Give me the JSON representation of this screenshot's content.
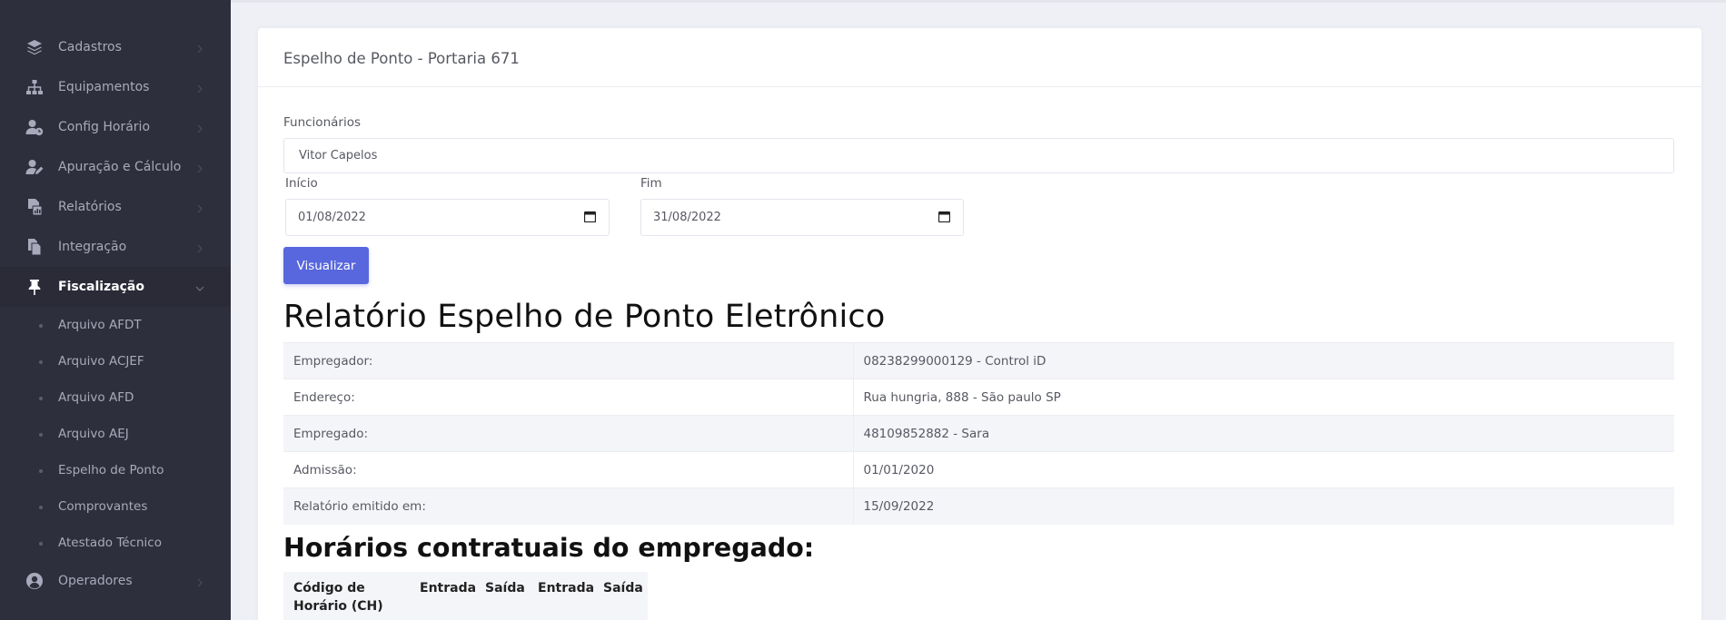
{
  "sidebar": {
    "items": [
      {
        "label": "Cadastros",
        "icon": "layers-icon"
      },
      {
        "label": "Equipamentos",
        "icon": "sitemap-icon"
      },
      {
        "label": "Config Horário",
        "icon": "user-clock-icon"
      },
      {
        "label": "Apuração e Cálculo",
        "icon": "user-edit-icon"
      },
      {
        "label": "Relatórios",
        "icon": "file-report-icon"
      },
      {
        "label": "Integração",
        "icon": "copy-files-icon"
      },
      {
        "label": "Fiscalização",
        "icon": "pin-icon"
      }
    ],
    "sub_items": [
      {
        "label": "Arquivo AFDT"
      },
      {
        "label": "Arquivo ACJEF"
      },
      {
        "label": "Arquivo AFD"
      },
      {
        "label": "Arquivo AEJ"
      },
      {
        "label": "Espelho de Ponto"
      },
      {
        "label": "Comprovantes"
      },
      {
        "label": "Atestado Técnico"
      }
    ],
    "bottom_item": {
      "label": "Operadores",
      "icon": "user-circle-icon"
    }
  },
  "card": {
    "title": "Espelho de Ponto - Portaria 671"
  },
  "form": {
    "employees_label": "Funcionários",
    "employees_value": "Vitor Capelos",
    "start_label": "Início",
    "start_value": "01/08/2022",
    "end_label": "Fim",
    "end_value": "31/08/2022",
    "submit_label": "Visualizar"
  },
  "report": {
    "title": "Relatório Espelho de Ponto Eletrônico",
    "rows": [
      {
        "key": "Empregador:",
        "value": "08238299000129 - Control iD"
      },
      {
        "key": "Endereço:",
        "value": "Rua hungria, 888 - São paulo SP"
      },
      {
        "key": "Empregado:",
        "value": "48109852882 - Sara"
      },
      {
        "key": "Admissão:",
        "value": "01/01/2020"
      },
      {
        "key": "Relatório emitido em:",
        "value": "15/09/2022"
      }
    ]
  },
  "schedule": {
    "title": "Horários contratuais do empregado:",
    "headers": [
      "Código de Horário (CH)",
      "Entrada",
      "Saída",
      "Entrada",
      "Saída"
    ]
  },
  "colors": {
    "sidebar_bg": "#2e2f3c",
    "accent": "#5867dd",
    "page_bg": "#eff0f6"
  }
}
